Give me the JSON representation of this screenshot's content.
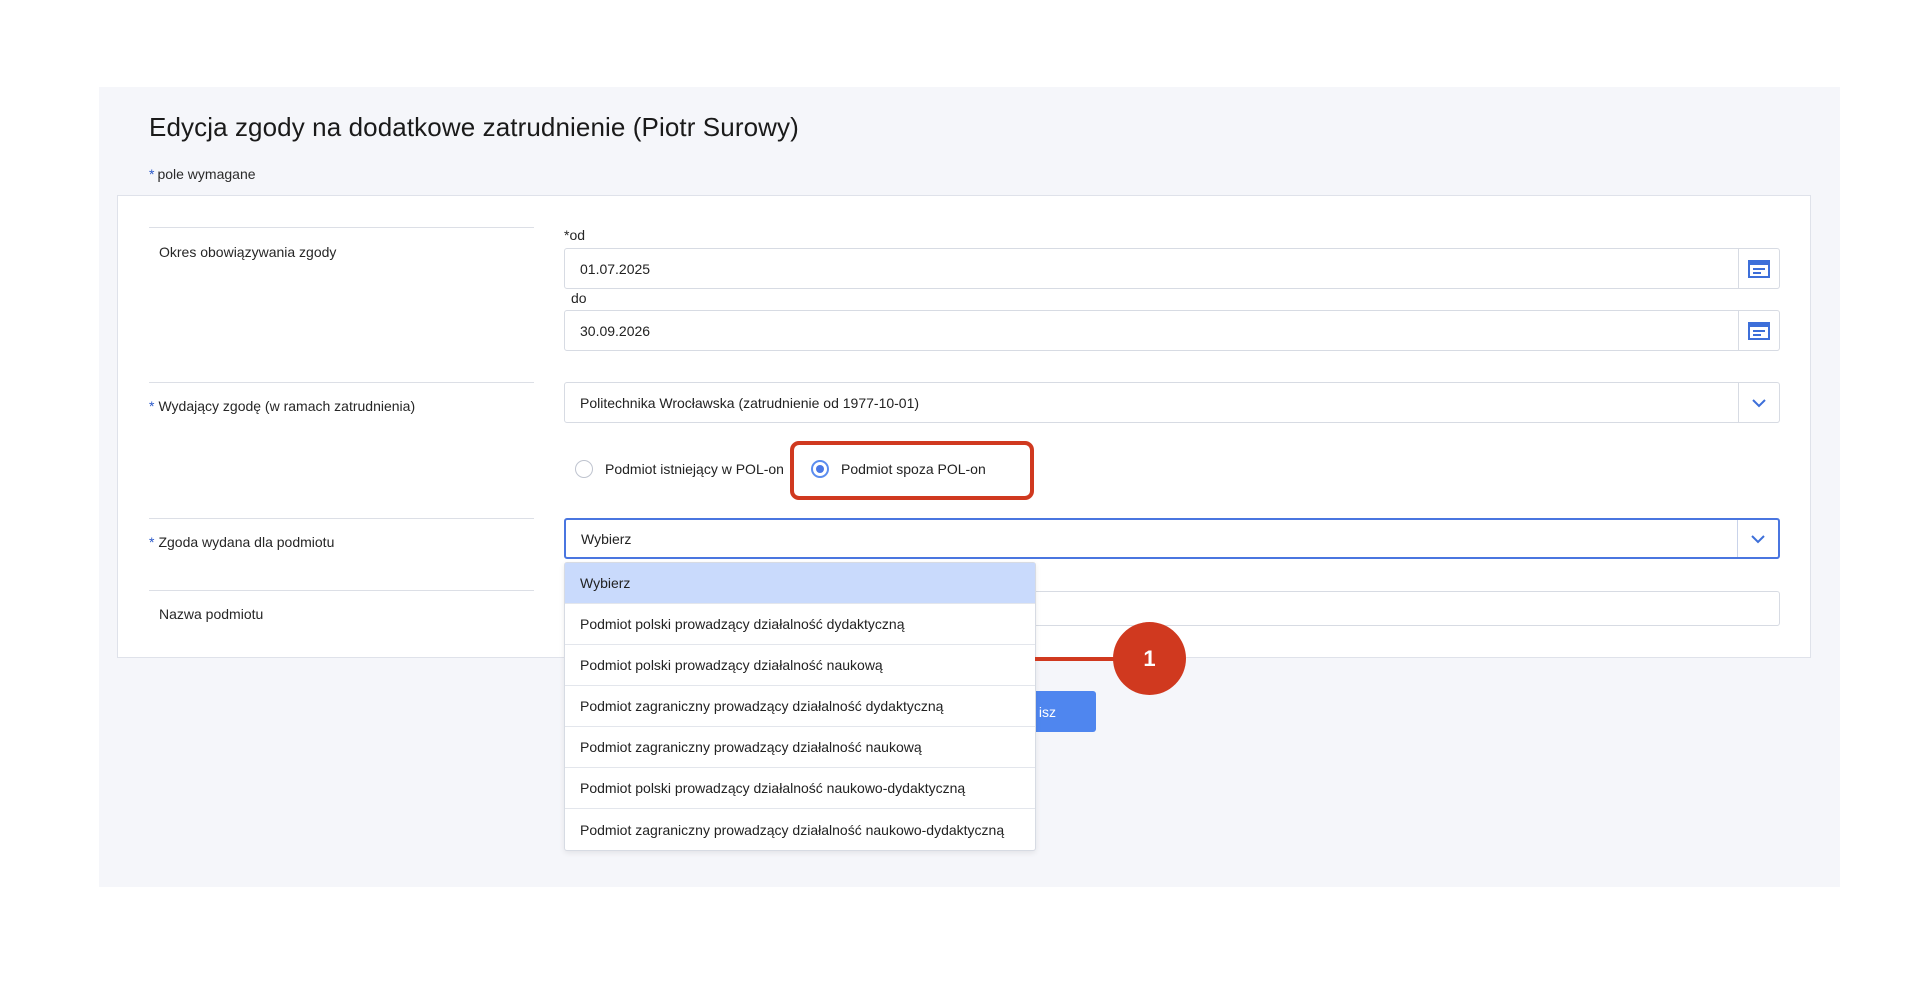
{
  "title": "Edycja zgody na dodatkowe zatrudnienie (Piotr Surowy)",
  "required_note": {
    "star": "*",
    "text": "pole wymagane"
  },
  "sections": {
    "okres": {
      "label": "Okres obowiązywania zgody",
      "from_label": "*od",
      "from_value": "01.07.2025",
      "to_label": "do",
      "to_value": "30.09.2026"
    },
    "wydajacy": {
      "star": "*",
      "label": "Wydający zgodę (w ramach zatrudnienia)",
      "selected": "Politechnika Wrocławska (zatrudnienie od 1977-10-01)"
    },
    "radios": {
      "option1": "Podmiot istniejący w POL-on",
      "option2": "Podmiot spoza POL-on",
      "checked": "option2"
    },
    "zgoda": {
      "star": "*",
      "label": "Zgoda wydana dla podmiotu",
      "selected": "Wybierz",
      "options": [
        "Wybierz",
        "Podmiot polski prowadzący działalność dydaktyczną",
        "Podmiot polski prowadzący działalność naukową",
        "Podmiot zagraniczny prowadzący działalność dydaktyczną",
        "Podmiot zagraniczny prowadzący działalność naukową",
        "Podmiot polski prowadzący działalność naukowo-dydaktyczną",
        "Podmiot zagraniczny prowadzący działalność naukowo-dydaktyczną"
      ]
    },
    "nazwa": {
      "label": "Nazwa podmiotu",
      "value": ""
    }
  },
  "save_button_label": "isz",
  "callout": {
    "number": "1"
  },
  "colors": {
    "accent": "#4a76e0",
    "annotation": "#d0391f",
    "panel": "#f5f6fa"
  },
  "icons": {
    "calendar": "calendar-icon",
    "chevron": "chevron-down-icon"
  }
}
